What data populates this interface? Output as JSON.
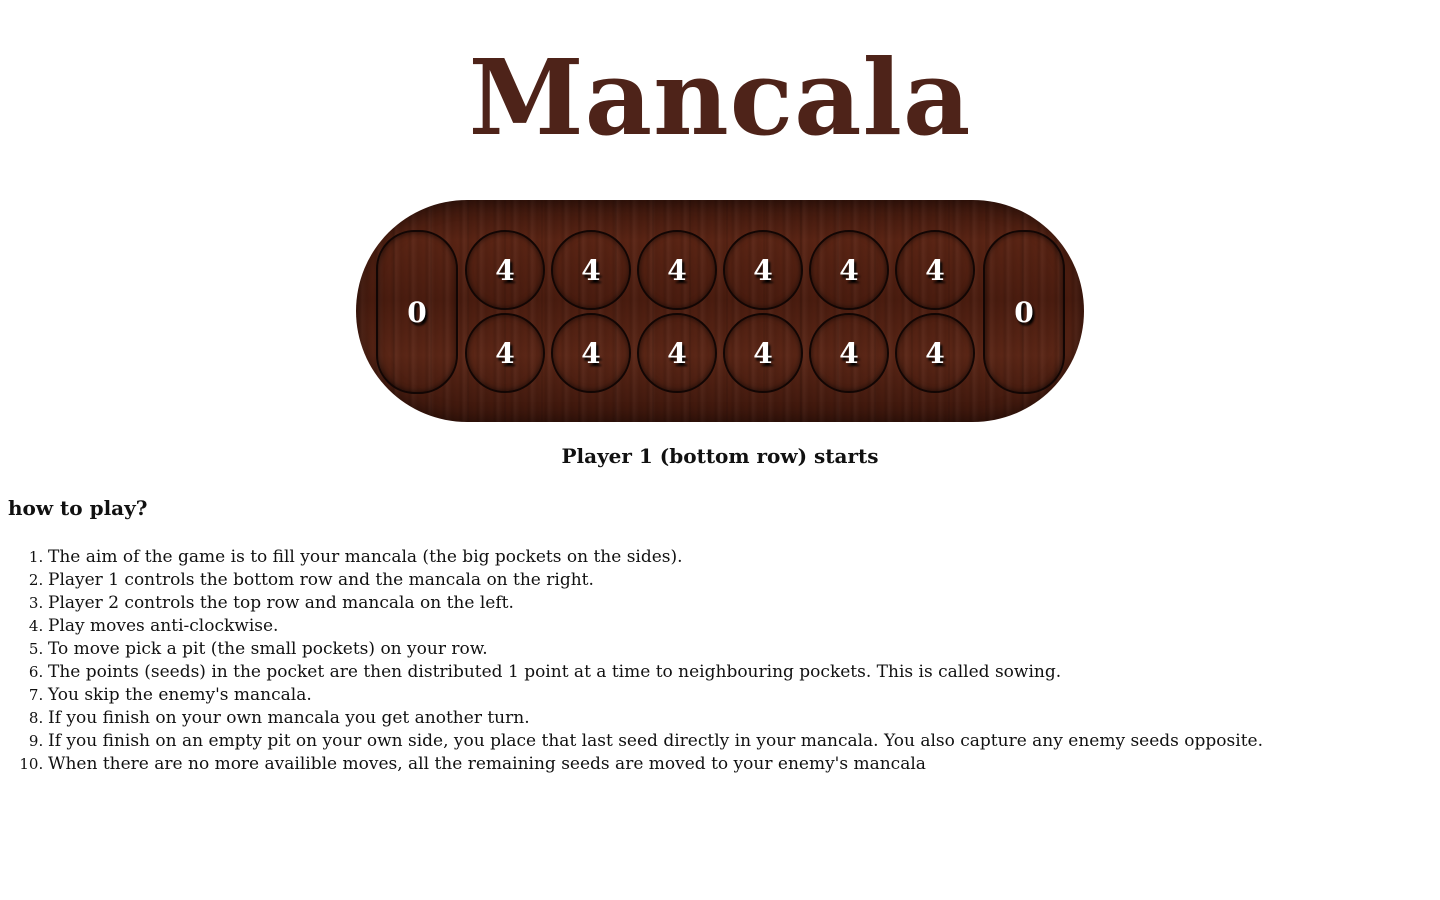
{
  "title": "Mancala",
  "board": {
    "stores": {
      "left": "0",
      "right": "0"
    },
    "top_row": [
      "4",
      "4",
      "4",
      "4",
      "4",
      "4"
    ],
    "bottom_row": [
      "4",
      "4",
      "4",
      "4",
      "4",
      "4"
    ]
  },
  "status": "Player 1 (bottom row) starts",
  "how_to_play": {
    "heading": "how to play?",
    "rules": [
      "The aim of the game is to fill your mancala (the big pockets on the sides).",
      "Player 1 controls the bottom row and the mancala on the right.",
      "Player 2 controls the top row and mancala on the left.",
      "Play moves anti-clockwise.",
      "To move pick a pit (the small pockets) on your row.",
      "The points (seeds) in the pocket are then distributed 1 point at a time to neighbouring pockets. This is called sowing.",
      "You skip the enemy's mancala.",
      "If you finish on your own mancala you get another turn.",
      "If you finish on an empty pit on your own side, you place that last seed directly in your mancala. You also capture any enemy seeds opposite.",
      "When there are no more availible moves, all the remaining seeds are moved to your enemy's mancala"
    ]
  },
  "colors": {
    "title": "#4e2319",
    "board": "#4a1c0f",
    "count_text": "#ffffff"
  }
}
